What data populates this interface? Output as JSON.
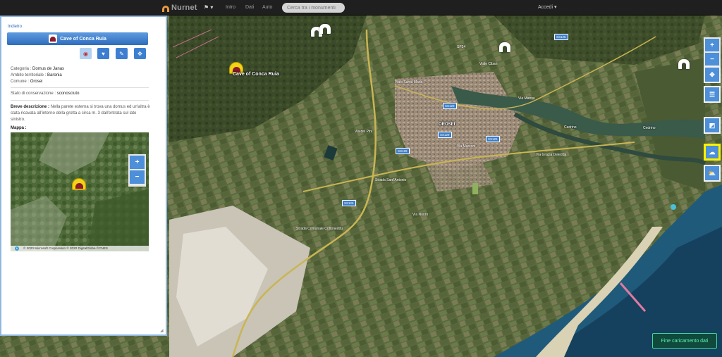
{
  "navbar": {
    "brand": "Nurnet",
    "flag_icon": "flag-icon",
    "flag_caret": "▾",
    "links": [
      "Intro",
      "Dati",
      "Auto"
    ],
    "search_placeholder": "Cerca tra i monumenti",
    "login": "Accedi ▾"
  },
  "panel": {
    "back_label": "Indietro",
    "title": "Cave of Conca Ruia",
    "actions": [
      "share-icon",
      "heart-icon",
      "wrench-icon",
      "move-icon"
    ],
    "category_label": "Categoria :",
    "category_value": "Domus de Janas",
    "territory_label": "Ambito territoriale :",
    "territory_value": "Baronia",
    "municipality_label": "Comune :",
    "municipality_value": "Orosei",
    "conservation_label": "Stato di conservazione :",
    "conservation_value": "sconosciuto",
    "description_label": "Breve descrizione :",
    "description_text": "Nella parete esterna si trova una domus ed un'altra è stata ricavata all'interno della grotta a circa m. 3 dall'entrata sul lato sinistro.",
    "map_label": "Mappa :",
    "minimap": {
      "zoom_in": "+",
      "zoom_out": "−",
      "attribution": "© 2020 Microsoft Corporation © 2020 DigitalGlobe ©CNES"
    }
  },
  "map": {
    "marker_label": "Cave of Conca Ruia",
    "town_label": "OROSEI",
    "road_shields": [
      "SS125",
      "SS129",
      "SS129",
      "SS125",
      "SS125",
      "SS129"
    ],
    "road_names": [
      "Viale Santa Maria",
      "Via Mannu",
      "Via Marconi",
      "SP24",
      "Strada Sant'Antonio",
      "Strada Comunale Cottoneddu",
      "Via dei Pini",
      "Viale Cibari",
      "Via Grazia Deledda",
      "Cedrino",
      "Cedrino",
      "Via Nuoro"
    ],
    "controls": {
      "zoom_in": "+",
      "zoom_out": "−",
      "locate_icon": "crosshair-icon",
      "list_icon": "list-icon",
      "layers_icon": "layers-icon",
      "basemap_icon": "map-style-icon",
      "weather_icon": "cloud-icon"
    },
    "toast": "Fine caricamento dati"
  }
}
